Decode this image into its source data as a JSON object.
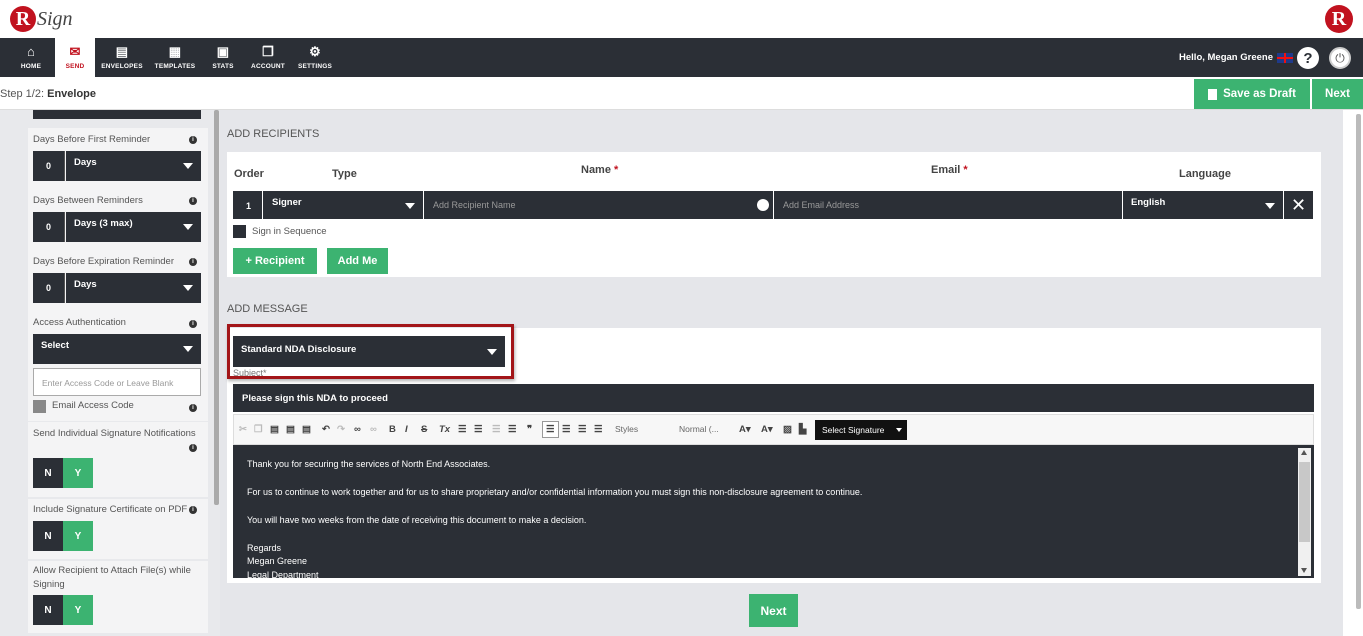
{
  "app": {
    "logo_text": "Sign"
  },
  "nav": {
    "items": [
      {
        "label": "HOME",
        "icon": "home-icon",
        "glyph": "⌂"
      },
      {
        "label": "SEND",
        "icon": "envelope-icon",
        "glyph": "✉"
      },
      {
        "label": "ENVELOPES",
        "icon": "inbox-icon",
        "glyph": "▤"
      },
      {
        "label": "TEMPLATES",
        "icon": "template-icon",
        "glyph": "▦"
      },
      {
        "label": "STATS",
        "icon": "briefcase-icon",
        "glyph": "▣"
      },
      {
        "label": "ACCOUNT",
        "icon": "copy-icon",
        "glyph": "❐"
      },
      {
        "label": "SETTINGS",
        "icon": "gear-icon",
        "glyph": "⚙"
      }
    ],
    "greeting": "Hello, Megan Greene"
  },
  "step": {
    "prefix": "Step 1/2:",
    "name": "Envelope"
  },
  "actions": {
    "save_draft": "Save as Draft",
    "next": "Next"
  },
  "settings": {
    "first_reminder": {
      "label": "Days Before First Reminder",
      "value": "0",
      "unit": "Days"
    },
    "between_reminders": {
      "label": "Days Between Reminders",
      "value": "0",
      "unit": "Days (3 max)"
    },
    "expiration_reminder": {
      "label": "Days Before Expiration Reminder",
      "value": "0",
      "unit": "Days"
    },
    "access_auth": {
      "label": "Access Authentication",
      "value": "Select",
      "placeholder": "Enter Access Code or Leave Blank",
      "email_code_label": "Email Access Code"
    },
    "individual_notifications": {
      "label": "Send Individual Signature Notifications",
      "no": "N",
      "yes": "Y"
    },
    "signature_certificate": {
      "label": "Include Signature Certificate on PDF",
      "no": "N",
      "yes": "Y"
    },
    "attach_files": {
      "label": "Allow Recipient to Attach File(s) while Signing",
      "no": "N",
      "yes": "Y"
    }
  },
  "recipients": {
    "title": "ADD RECIPIENTS",
    "headers": {
      "order": "Order",
      "type": "Type",
      "name": "Name",
      "email": "Email",
      "language": "Language",
      "required_mark": "*"
    },
    "row": {
      "order": "1",
      "type": "Signer",
      "name_placeholder": "Add Recipient Name",
      "email_placeholder": "Add Email Address",
      "language": "English"
    },
    "sign_in_sequence": "Sign in Sequence",
    "add_recipient": "+ Recipient",
    "add_me": "Add Me"
  },
  "message": {
    "title": "ADD MESSAGE",
    "template": "Standard NDA Disclosure",
    "subject_label": "Subject*",
    "subject": "Please sign this NDA to proceed",
    "toolbar": {
      "styles": "Styles",
      "format": "Normal (...",
      "signature": "Select Signature"
    },
    "body": [
      "Thank you for securing the services of North End Associates.",
      "For us to continue to work together and for us to share proprietary and/or confidential information you must sign this non-disclosure agreement to continue.",
      "You will have two weeks from the date of receiving this document to make a decision.",
      "Regards",
      "Megan Greene",
      "Legal Department"
    ]
  },
  "colors": {
    "brand_red": "#c1121f",
    "dark": "#2b2f36",
    "green": "#3cb371"
  }
}
